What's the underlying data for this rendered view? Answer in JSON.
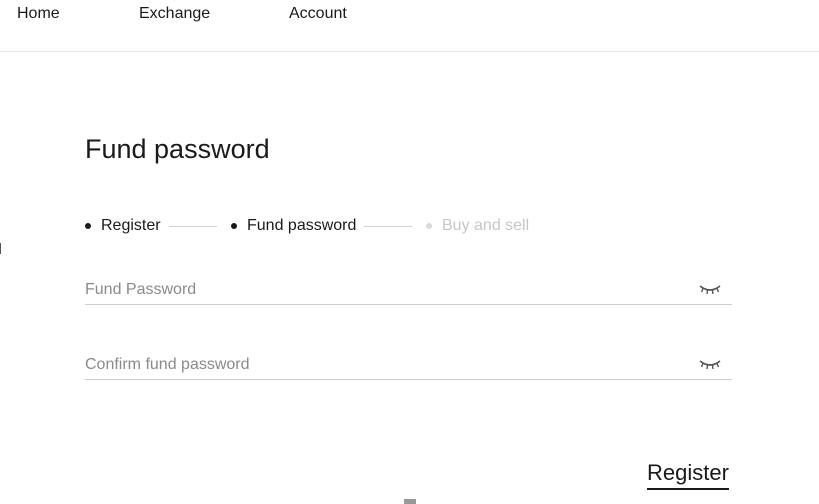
{
  "nav": {
    "home": "Home",
    "exchange": "Exchange",
    "account": "Account"
  },
  "page": {
    "title": "Fund password"
  },
  "steps": [
    {
      "label": "Register",
      "state": "done"
    },
    {
      "label": "Fund password",
      "state": "current"
    },
    {
      "label": "Buy and sell",
      "state": "pending"
    }
  ],
  "form": {
    "fund_password": {
      "placeholder": "Fund Password",
      "value": "",
      "icon": "eye-closed-icon"
    },
    "confirm_password": {
      "placeholder": "Confirm fund password",
      "value": "",
      "icon": "eye-closed-icon"
    },
    "submit_label": "Register"
  },
  "colors": {
    "text": "#1a1a1a",
    "inactive_step": "#c7c7c7",
    "placeholder": "#8a8a8a",
    "divider": "#e6e6e6"
  }
}
